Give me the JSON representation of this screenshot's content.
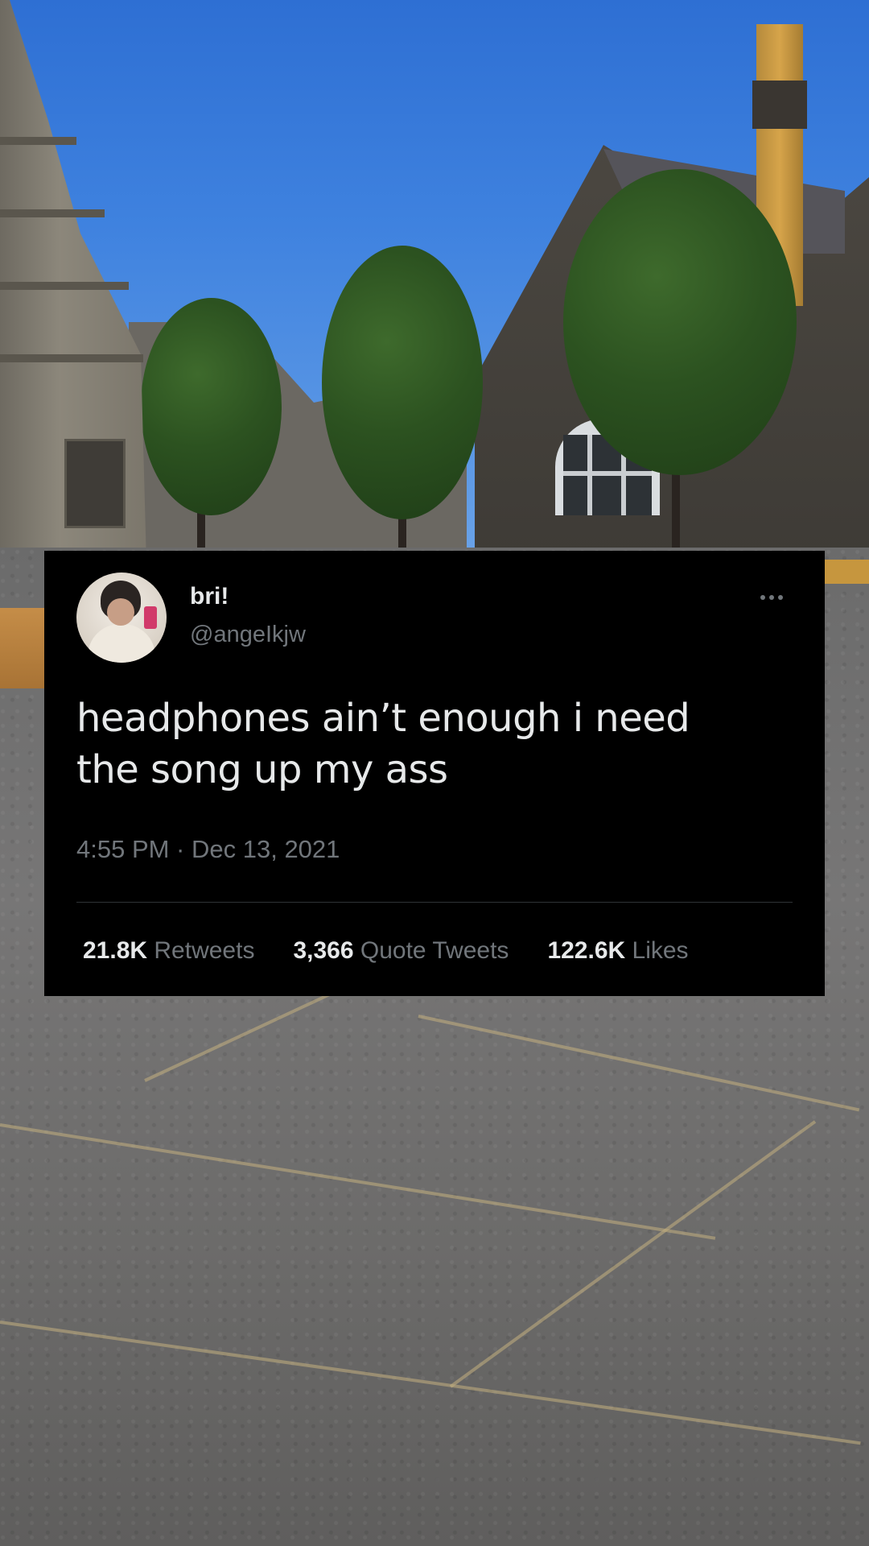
{
  "tweet": {
    "display_name": "bri!",
    "handle": "@angeIkjw",
    "text_line1": "headphones ain’t enough i need",
    "text_line2": "the song up my ass",
    "timestamp": "4:55 PM · Dec 13, 2021",
    "stats": {
      "retweets_count": "21.8K",
      "retweets_label": "Retweets",
      "quote_tweets_count": "3,366",
      "quote_tweets_label": "Quote Tweets",
      "likes_count": "122.6K",
      "likes_label": "Likes"
    },
    "colors": {
      "background": "#000000",
      "primary_text": "#e7e9ea",
      "secondary_text": "#71767b",
      "divider": "#2f3336"
    }
  },
  "background": {
    "sky_color": "#3f82df",
    "pavement_color": "#6f6e6d"
  },
  "icons": {
    "more": "more-horizontal-icon",
    "avatar": "profile-avatar"
  }
}
